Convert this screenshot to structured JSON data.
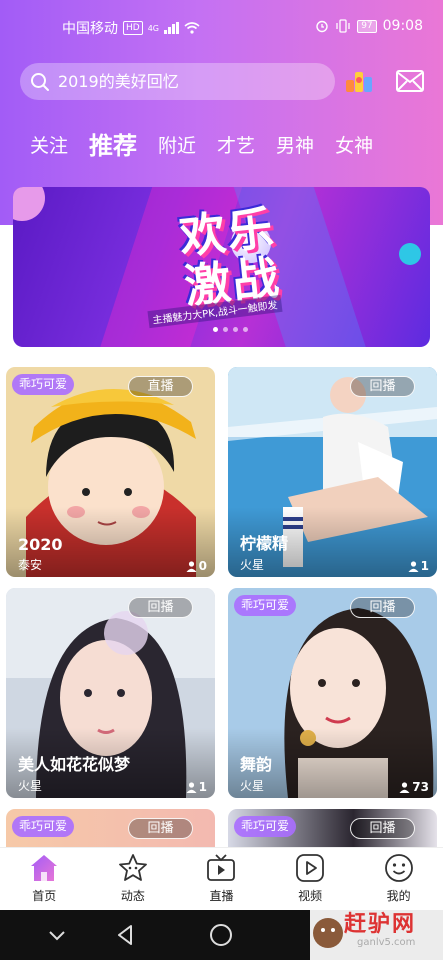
{
  "status_bar": {
    "carrier": "中国移动",
    "hd": "HD",
    "network": "4G",
    "battery": "97",
    "time": "09:08"
  },
  "search": {
    "placeholder": "2019的美好回忆"
  },
  "tabs": [
    {
      "label": "关注",
      "active": false
    },
    {
      "label": "推荐",
      "active": true
    },
    {
      "label": "附近",
      "active": false
    },
    {
      "label": "才艺",
      "active": false
    },
    {
      "label": "男神",
      "active": false
    },
    {
      "label": "女神",
      "active": false
    }
  ],
  "banner": {
    "title_line1": "欢乐",
    "title_line2": "激战",
    "subtitle": "主播魅力大PK,战斗一触即发",
    "slide_count": 4,
    "active_slide": 1
  },
  "cards": [
    {
      "tag": "乖巧可爱",
      "badge": "直播",
      "name": "2020",
      "location": "泰安",
      "viewers": "0"
    },
    {
      "tag": "",
      "badge": "回播",
      "name": "柠檬精",
      "location": "火星",
      "viewers": "1"
    },
    {
      "tag": "",
      "badge": "回播",
      "name": "美人如花花似梦",
      "location": "火星",
      "viewers": "1"
    },
    {
      "tag": "乖巧可爱",
      "badge": "回播",
      "name": "舞韵",
      "location": "火星",
      "viewers": "73"
    },
    {
      "tag": "乖巧可爱",
      "badge": "回播",
      "name": "",
      "location": "",
      "viewers": ""
    },
    {
      "tag": "乖巧可爱",
      "badge": "回播",
      "name": "",
      "location": "",
      "viewers": ""
    }
  ],
  "bottom_nav": [
    {
      "label": "首页",
      "icon": "home-icon",
      "active": true
    },
    {
      "label": "动态",
      "icon": "star-icon",
      "active": false
    },
    {
      "label": "直播",
      "icon": "tv-icon",
      "active": false
    },
    {
      "label": "视频",
      "icon": "play-icon",
      "active": false
    },
    {
      "label": "我的",
      "icon": "smile-icon",
      "active": false
    }
  ],
  "watermark": {
    "text": "赶驴网",
    "url": "ganlv5.com"
  },
  "colors": {
    "accent": "#a25cf6",
    "accent_end": "#ea77d6",
    "tag_bg": "#aa6eff"
  }
}
